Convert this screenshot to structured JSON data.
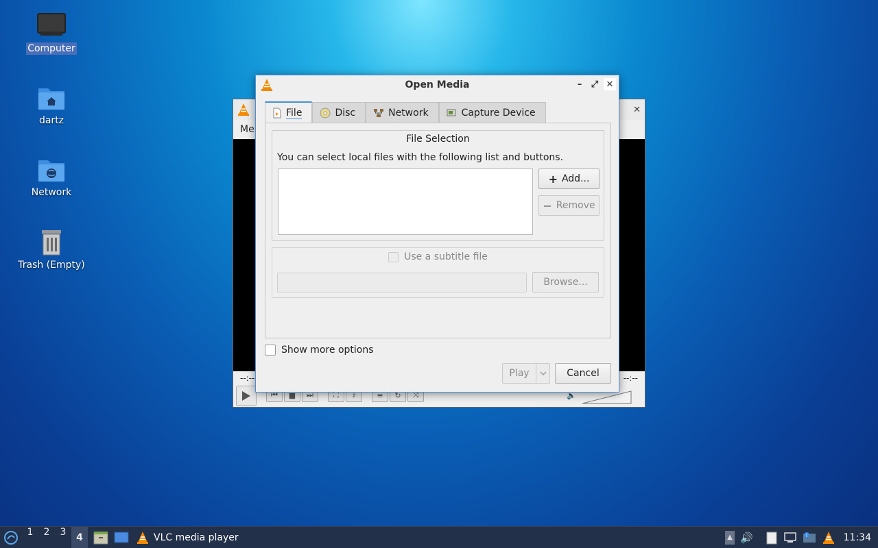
{
  "desktop": {
    "icons": [
      {
        "label": "Computer",
        "icon": "computer-icon"
      },
      {
        "label": "dartz",
        "icon": "home-folder-icon"
      },
      {
        "label": "Network",
        "icon": "network-folder-icon"
      },
      {
        "label": "Trash (Empty)",
        "icon": "trash-icon"
      }
    ]
  },
  "vlc_main": {
    "menu_partial": "Me",
    "time_left": "--:--",
    "time_right": "--:--",
    "volume_percent": "0%"
  },
  "dialog": {
    "title": "Open Media",
    "tabs": [
      {
        "label": "File",
        "icon": "file-icon",
        "active": true
      },
      {
        "label": "Disc",
        "icon": "disc-icon",
        "active": false
      },
      {
        "label": "Network",
        "icon": "network-icon",
        "active": false
      },
      {
        "label": "Capture Device",
        "icon": "capture-device-icon",
        "active": false
      }
    ],
    "file_selection": {
      "title": "File Selection",
      "description": "You can select local files with the following list and buttons.",
      "add_label": "Add...",
      "remove_label": "Remove"
    },
    "subtitle": {
      "label": "Use a subtitle file",
      "browse_label": "Browse..."
    },
    "show_more_label": "Show more options",
    "play_label": "Play",
    "cancel_label": "Cancel"
  },
  "taskbar": {
    "workspaces": [
      "1",
      "2",
      "3",
      "4"
    ],
    "active_workspace": "4",
    "app_label": "VLC media player",
    "clock": "11:34"
  },
  "colors": {
    "accent": "#4a90d9",
    "taskbar": "#223049",
    "vlc_orange": "#f28a00"
  }
}
